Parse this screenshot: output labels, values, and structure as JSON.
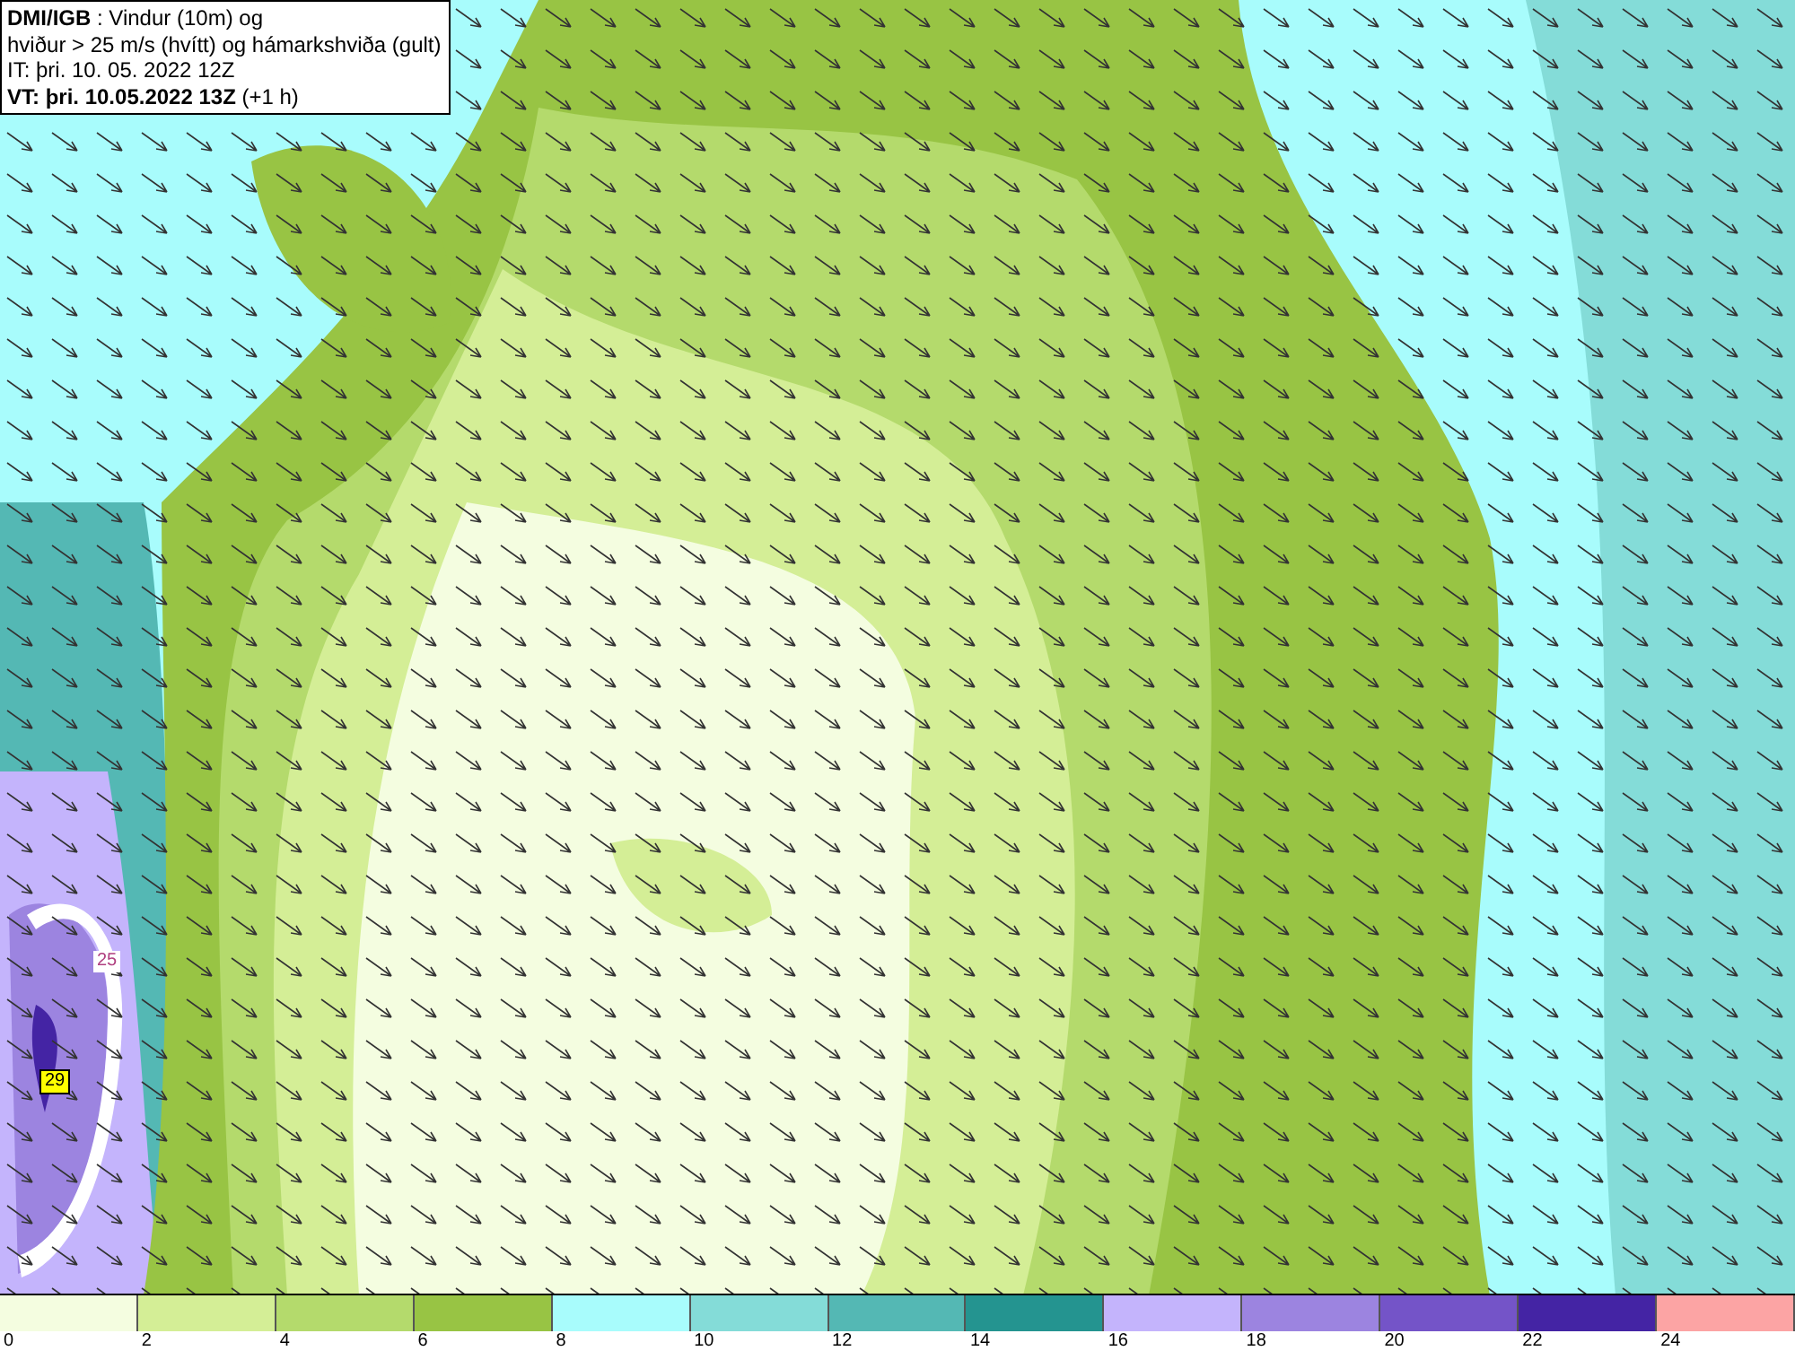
{
  "header": {
    "lines": [
      "**DMI/IGB** : Vindur (10m) og",
      "hviður > 25 m/s (hvítt) og hámarkshviða (gult)",
      "IT: þri. 10. 05. 2022 12Z",
      "**VT: þri. 10.05.2022 13Z** (+1 h)"
    ]
  },
  "map": {
    "labels": [
      {
        "text": "25",
        "kind": "gust"
      },
      {
        "text": "29",
        "kind": "max"
      }
    ]
  },
  "legend": {
    "bins": [
      {
        "label": "0",
        "color": "#f4fde0"
      },
      {
        "label": "2",
        "color": "#d4ee96"
      },
      {
        "label": "4",
        "color": "#b4da6c"
      },
      {
        "label": "6",
        "color": "#98c444"
      },
      {
        "label": "8",
        "color": "#a8fcfc"
      },
      {
        "label": "10",
        "color": "#84dcd8"
      },
      {
        "label": "12",
        "color": "#54b8b4"
      },
      {
        "label": "14",
        "color": "#249490"
      },
      {
        "label": "16",
        "color": "#c4b4fc"
      },
      {
        "label": "18",
        "color": "#9c84e0"
      },
      {
        "label": "20",
        "color": "#7454c8"
      },
      {
        "label": "22",
        "color": "#4424a4"
      },
      {
        "label": "24",
        "color": "#fca4a4"
      }
    ]
  }
}
